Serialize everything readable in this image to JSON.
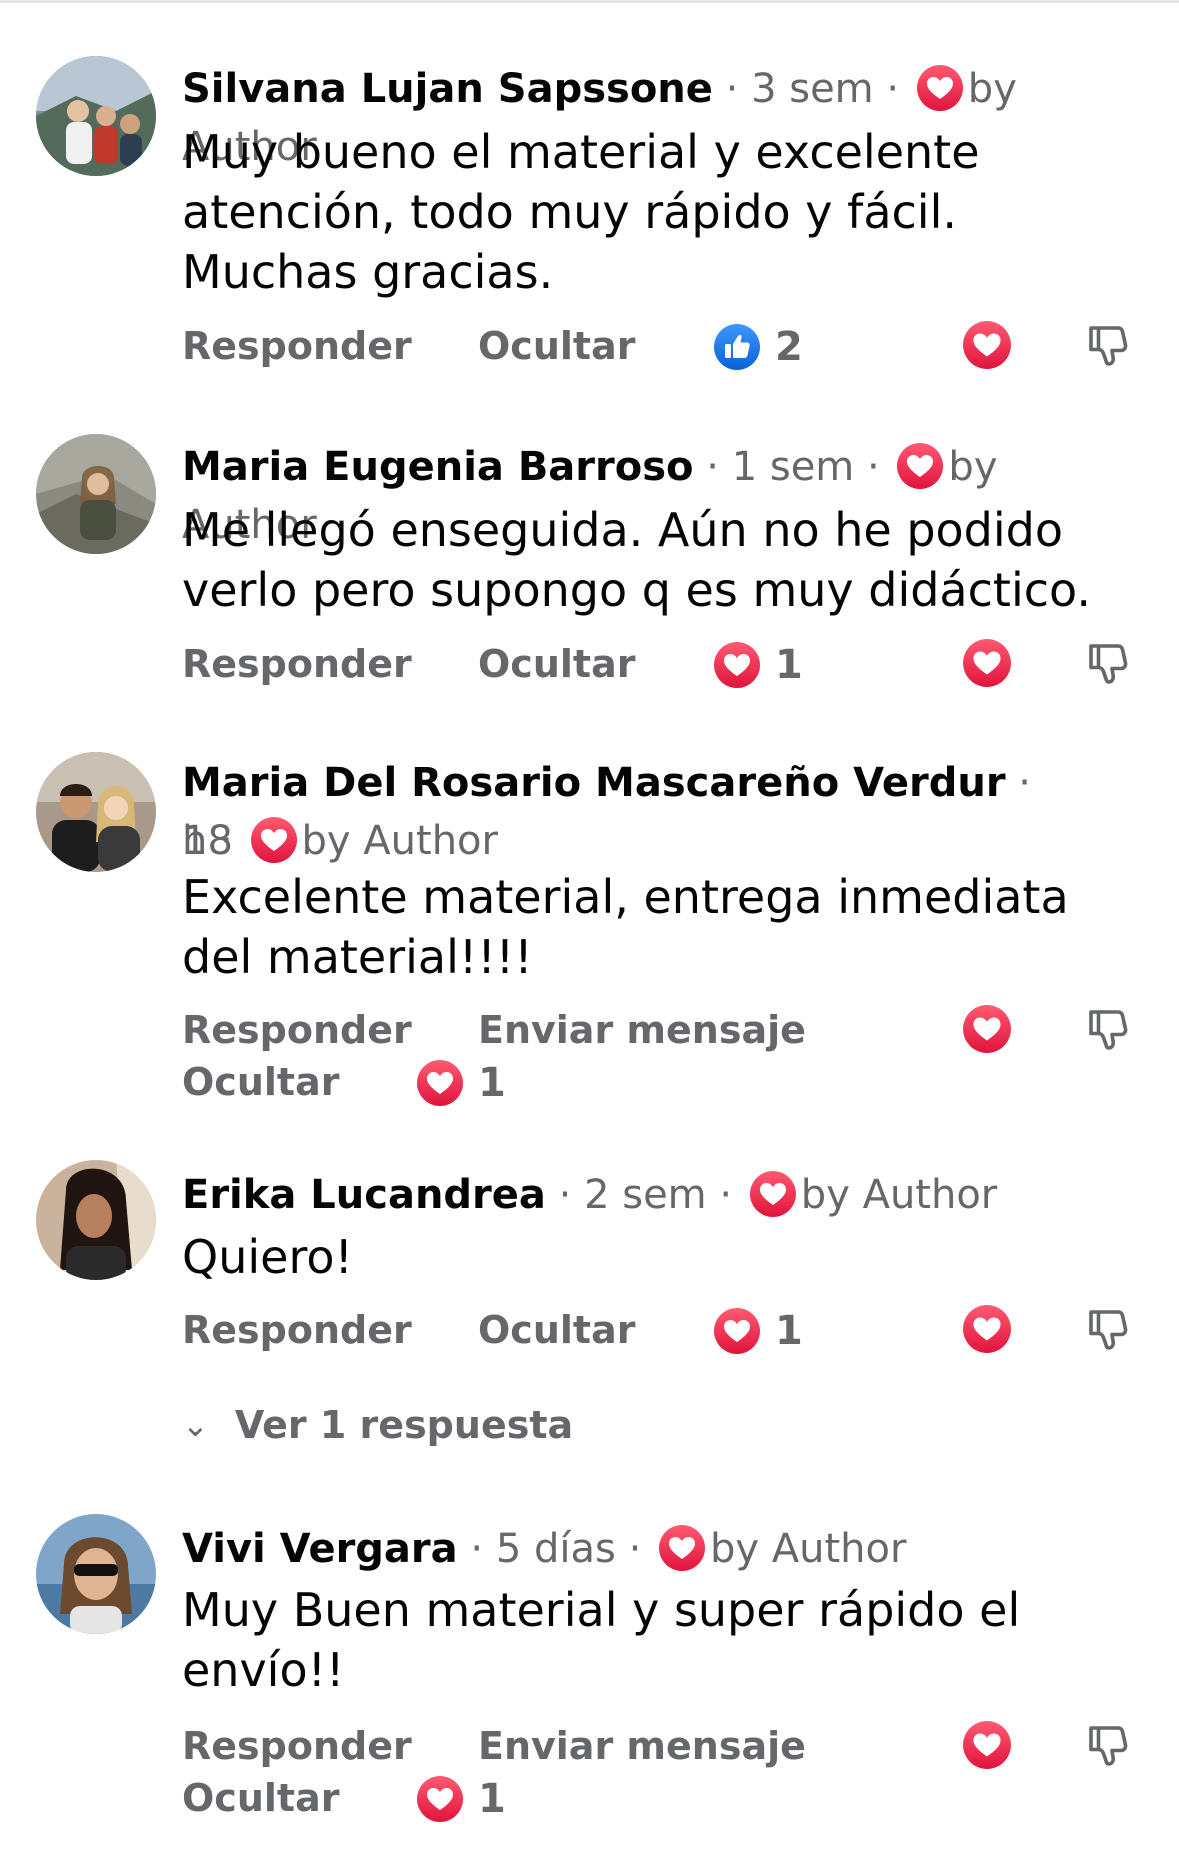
{
  "colors": {
    "heart_red": "#f0284a",
    "like_blue": "#1877f2",
    "meta_gray": "#65676b",
    "text_black": "#050505"
  },
  "labels": {
    "sep": "·",
    "by_author": "by Author",
    "reply": "Responder",
    "hide": "Ocultar",
    "send_message": "Enviar mensaje"
  },
  "comments": [
    {
      "author": "Silvana Lujan Sapssone",
      "time": "3 sem",
      "text": "Muy bueno el material y excelente atención, todo muy rápido y fácil. Muchas gracias.",
      "reaction_icon": "like-icon",
      "reaction_count": "2"
    },
    {
      "author": "Maria Eugenia Barroso",
      "time": "1 sem",
      "text": "Me llegó enseguida. Aún no he podido verlo pero supongo q es muy didáctico.",
      "reaction_icon": "love-icon",
      "reaction_count": "1"
    },
    {
      "author": "Maria Del Rosario Mascareño Verdur",
      "time_part1": "18",
      "time_part2": "h",
      "text": "Excelente material, entrega inmediata del material!!!!",
      "reaction_icon": "love-icon",
      "reaction_count": "1"
    },
    {
      "author": "Erika Lucandrea",
      "time": "2 sem",
      "text": "Quiero!",
      "reaction_icon": "love-icon",
      "reaction_count": "1",
      "view_replies": "Ver 1 respuesta"
    },
    {
      "author": "Vivi Vergara",
      "time": "5 días",
      "text": "Muy Buen material y super rápido el envío!!",
      "reaction_icon": "love-icon",
      "reaction_count": "1"
    }
  ]
}
